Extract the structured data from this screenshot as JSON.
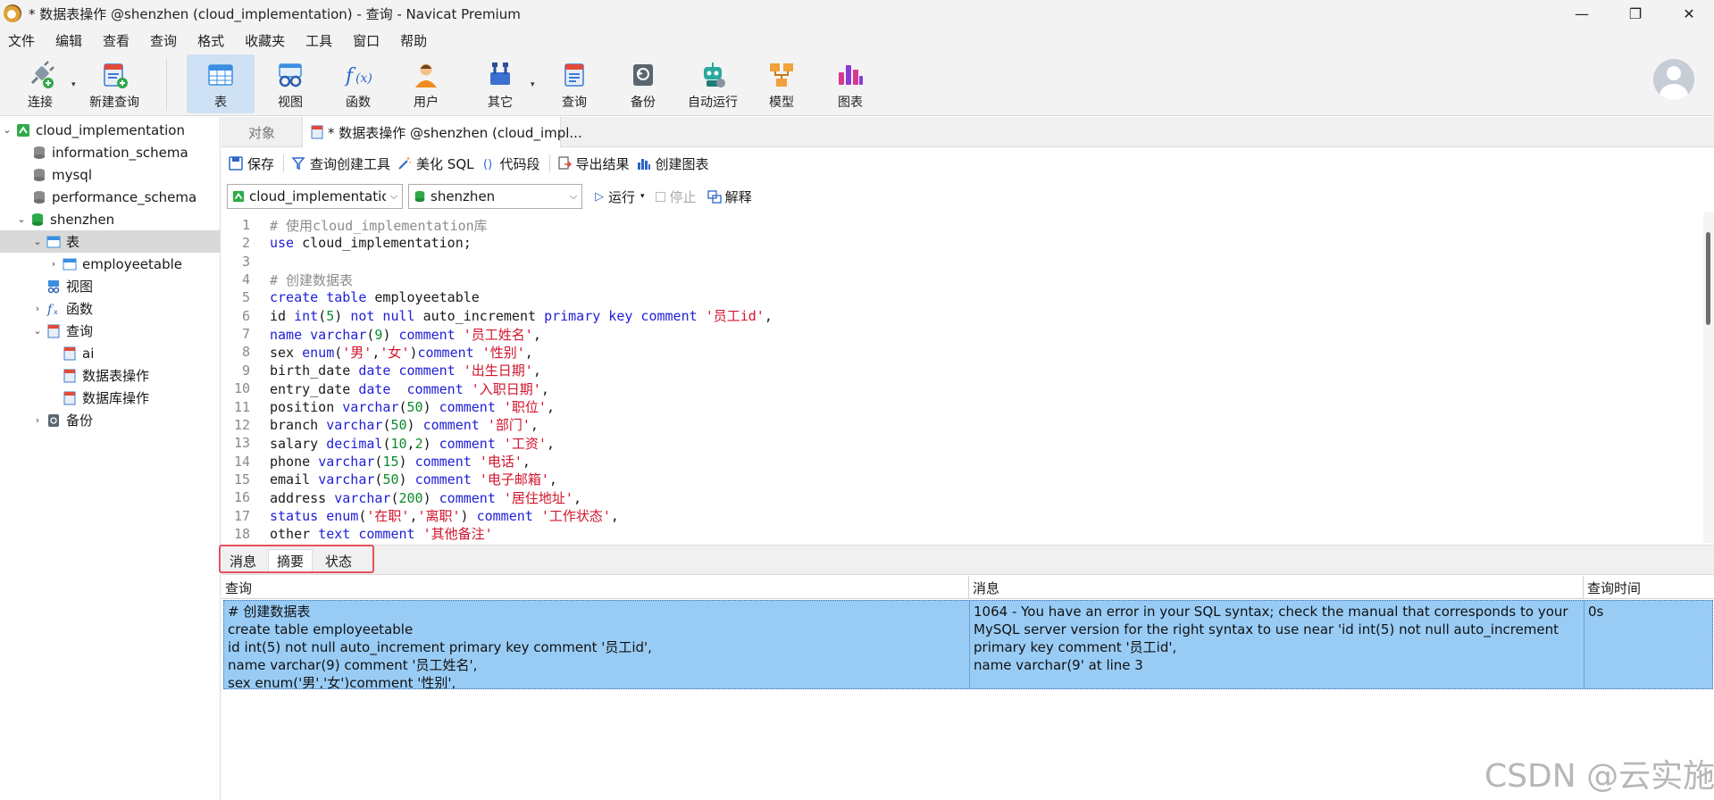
{
  "window": {
    "title": "* 数据表操作 @shenzhen (cloud_implementation) - 查询 - Navicat Premium",
    "minimize": "—",
    "maximize": "❐",
    "close": "✕"
  },
  "menu": [
    "文件",
    "编辑",
    "查看",
    "查询",
    "格式",
    "收藏夹",
    "工具",
    "窗口",
    "帮助"
  ],
  "toolbar": {
    "connect": "连接",
    "new_query": "新建查询",
    "table": "表",
    "view": "视图",
    "function": "函数",
    "user": "用户",
    "other": "其它",
    "query": "查询",
    "backup": "备份",
    "auto_run": "自动运行",
    "model": "模型",
    "chart": "图表"
  },
  "sidebar": {
    "connection": "cloud_implementation",
    "databases": [
      "information_schema",
      "mysql",
      "performance_schema"
    ],
    "shenzhen": "shenzhen",
    "tables_node": "表",
    "table_item": "employeetable",
    "views_node": "视图",
    "functions_node": "函数",
    "queries_node": "查询",
    "query_items": [
      "ai",
      "数据表操作",
      "数据库操作"
    ],
    "backups_node": "备份"
  },
  "tabs": {
    "objects": "对象",
    "query_tab": "* 数据表操作 @shenzhen (cloud_impl..."
  },
  "query_toolbar": {
    "save": "保存",
    "query_builder": "查询创建工具",
    "beautify": "美化 SQL",
    "snippet": "代码段",
    "export": "导出结果",
    "create_chart": "创建图表"
  },
  "selectors": {
    "connection": "cloud_implementation",
    "database": "shenzhen",
    "run": "运行",
    "stop": "停止",
    "explain": "解释"
  },
  "editor": {
    "lines": [
      [
        {
          "t": "# 使用cloud_implementation库",
          "c": "comment"
        }
      ],
      [
        {
          "t": "use",
          "c": "kw"
        },
        {
          "t": " cloud_implementation;",
          "c": "id"
        }
      ],
      [],
      [
        {
          "t": "# 创建数据表",
          "c": "comment"
        }
      ],
      [
        {
          "t": "create table",
          "c": "kw"
        },
        {
          "t": " employeetable",
          "c": "id"
        }
      ],
      [
        {
          "t": "id ",
          "c": "id"
        },
        {
          "t": "int",
          "c": "kw"
        },
        {
          "t": "(",
          "c": "id"
        },
        {
          "t": "5",
          "c": "num"
        },
        {
          "t": ") ",
          "c": "id"
        },
        {
          "t": "not null",
          "c": "kw"
        },
        {
          "t": " auto_increment ",
          "c": "id"
        },
        {
          "t": "primary key comment",
          "c": "kw"
        },
        {
          "t": " ",
          "c": "id"
        },
        {
          "t": "'员工id'",
          "c": "str"
        },
        {
          "t": ",",
          "c": "id"
        }
      ],
      [
        {
          "t": "name ",
          "c": "kw"
        },
        {
          "t": "varchar",
          "c": "kw"
        },
        {
          "t": "(",
          "c": "id"
        },
        {
          "t": "9",
          "c": "num"
        },
        {
          "t": ") ",
          "c": "id"
        },
        {
          "t": "comment",
          "c": "kw"
        },
        {
          "t": " ",
          "c": "id"
        },
        {
          "t": "'员工姓名'",
          "c": "str"
        },
        {
          "t": ",",
          "c": "id"
        }
      ],
      [
        {
          "t": "sex ",
          "c": "id"
        },
        {
          "t": "enum",
          "c": "kw"
        },
        {
          "t": "(",
          "c": "id"
        },
        {
          "t": "'男'",
          "c": "str"
        },
        {
          "t": ",",
          "c": "id"
        },
        {
          "t": "'女'",
          "c": "str"
        },
        {
          "t": ")",
          "c": "id"
        },
        {
          "t": "comment",
          "c": "kw"
        },
        {
          "t": " ",
          "c": "id"
        },
        {
          "t": "'性别'",
          "c": "str"
        },
        {
          "t": ",",
          "c": "id"
        }
      ],
      [
        {
          "t": "birth_date ",
          "c": "id"
        },
        {
          "t": "date comment",
          "c": "kw"
        },
        {
          "t": " ",
          "c": "id"
        },
        {
          "t": "'出生日期'",
          "c": "str"
        },
        {
          "t": ",",
          "c": "id"
        }
      ],
      [
        {
          "t": "entry_date ",
          "c": "id"
        },
        {
          "t": "date",
          "c": "kw"
        },
        {
          "t": "  ",
          "c": "id"
        },
        {
          "t": "comment",
          "c": "kw"
        },
        {
          "t": " ",
          "c": "id"
        },
        {
          "t": "'入职日期'",
          "c": "str"
        },
        {
          "t": ",",
          "c": "id"
        }
      ],
      [
        {
          "t": "position ",
          "c": "id"
        },
        {
          "t": "varchar",
          "c": "kw"
        },
        {
          "t": "(",
          "c": "id"
        },
        {
          "t": "50",
          "c": "num"
        },
        {
          "t": ") ",
          "c": "id"
        },
        {
          "t": "comment",
          "c": "kw"
        },
        {
          "t": " ",
          "c": "id"
        },
        {
          "t": "'职位'",
          "c": "str"
        },
        {
          "t": ",",
          "c": "id"
        }
      ],
      [
        {
          "t": "branch ",
          "c": "id"
        },
        {
          "t": "varchar",
          "c": "kw"
        },
        {
          "t": "(",
          "c": "id"
        },
        {
          "t": "50",
          "c": "num"
        },
        {
          "t": ") ",
          "c": "id"
        },
        {
          "t": "comment",
          "c": "kw"
        },
        {
          "t": " ",
          "c": "id"
        },
        {
          "t": "'部门'",
          "c": "str"
        },
        {
          "t": ",",
          "c": "id"
        }
      ],
      [
        {
          "t": "salary ",
          "c": "id"
        },
        {
          "t": "decimal",
          "c": "kw"
        },
        {
          "t": "(",
          "c": "id"
        },
        {
          "t": "10",
          "c": "num"
        },
        {
          "t": ",",
          "c": "id"
        },
        {
          "t": "2",
          "c": "num"
        },
        {
          "t": ") ",
          "c": "id"
        },
        {
          "t": "comment",
          "c": "kw"
        },
        {
          "t": " ",
          "c": "id"
        },
        {
          "t": "'工资'",
          "c": "str"
        },
        {
          "t": ",",
          "c": "id"
        }
      ],
      [
        {
          "t": "phone ",
          "c": "id"
        },
        {
          "t": "varchar",
          "c": "kw"
        },
        {
          "t": "(",
          "c": "id"
        },
        {
          "t": "15",
          "c": "num"
        },
        {
          "t": ") ",
          "c": "id"
        },
        {
          "t": "comment",
          "c": "kw"
        },
        {
          "t": " ",
          "c": "id"
        },
        {
          "t": "'电话'",
          "c": "str"
        },
        {
          "t": ",",
          "c": "id"
        }
      ],
      [
        {
          "t": "email ",
          "c": "id"
        },
        {
          "t": "varchar",
          "c": "kw"
        },
        {
          "t": "(",
          "c": "id"
        },
        {
          "t": "50",
          "c": "num"
        },
        {
          "t": ") ",
          "c": "id"
        },
        {
          "t": "comment",
          "c": "kw"
        },
        {
          "t": " ",
          "c": "id"
        },
        {
          "t": "'电子邮箱'",
          "c": "str"
        },
        {
          "t": ",",
          "c": "id"
        }
      ],
      [
        {
          "t": "address ",
          "c": "id"
        },
        {
          "t": "varchar",
          "c": "kw"
        },
        {
          "t": "(",
          "c": "id"
        },
        {
          "t": "200",
          "c": "num"
        },
        {
          "t": ") ",
          "c": "id"
        },
        {
          "t": "comment",
          "c": "kw"
        },
        {
          "t": " ",
          "c": "id"
        },
        {
          "t": "'居住地址'",
          "c": "str"
        },
        {
          "t": ",",
          "c": "id"
        }
      ],
      [
        {
          "t": "status ",
          "c": "kw"
        },
        {
          "t": "enum",
          "c": "kw"
        },
        {
          "t": "(",
          "c": "id"
        },
        {
          "t": "'在职'",
          "c": "str"
        },
        {
          "t": ",",
          "c": "id"
        },
        {
          "t": "'离职'",
          "c": "str"
        },
        {
          "t": ") ",
          "c": "id"
        },
        {
          "t": "comment",
          "c": "kw"
        },
        {
          "t": " ",
          "c": "id"
        },
        {
          "t": "'工作状态'",
          "c": "str"
        },
        {
          "t": ",",
          "c": "id"
        }
      ],
      [
        {
          "t": "other ",
          "c": "id"
        },
        {
          "t": "text comment",
          "c": "kw"
        },
        {
          "t": " ",
          "c": "id"
        },
        {
          "t": "'其他备注'",
          "c": "str"
        }
      ]
    ]
  },
  "result_tabs": [
    "消息",
    "摘要",
    "状态"
  ],
  "grid": {
    "headers": [
      "查询",
      "消息",
      "查询时间"
    ],
    "row": {
      "query": "# 创建数据表\ncreate table employeetable\nid int(5) not null auto_increment primary key comment '员工id',\nname varchar(9) comment '员工姓名',\nsex enum('男','女')comment '性别',",
      "message": "1064 - You have an error in your SQL syntax; check the manual that corresponds to your\nMySQL server version for the right syntax to use near 'id int(5) not null auto_increment\nprimary key comment '员工id',\nname varchar(9' at line 3",
      "time": "0s"
    }
  },
  "watermark": "CSDN @云实施"
}
